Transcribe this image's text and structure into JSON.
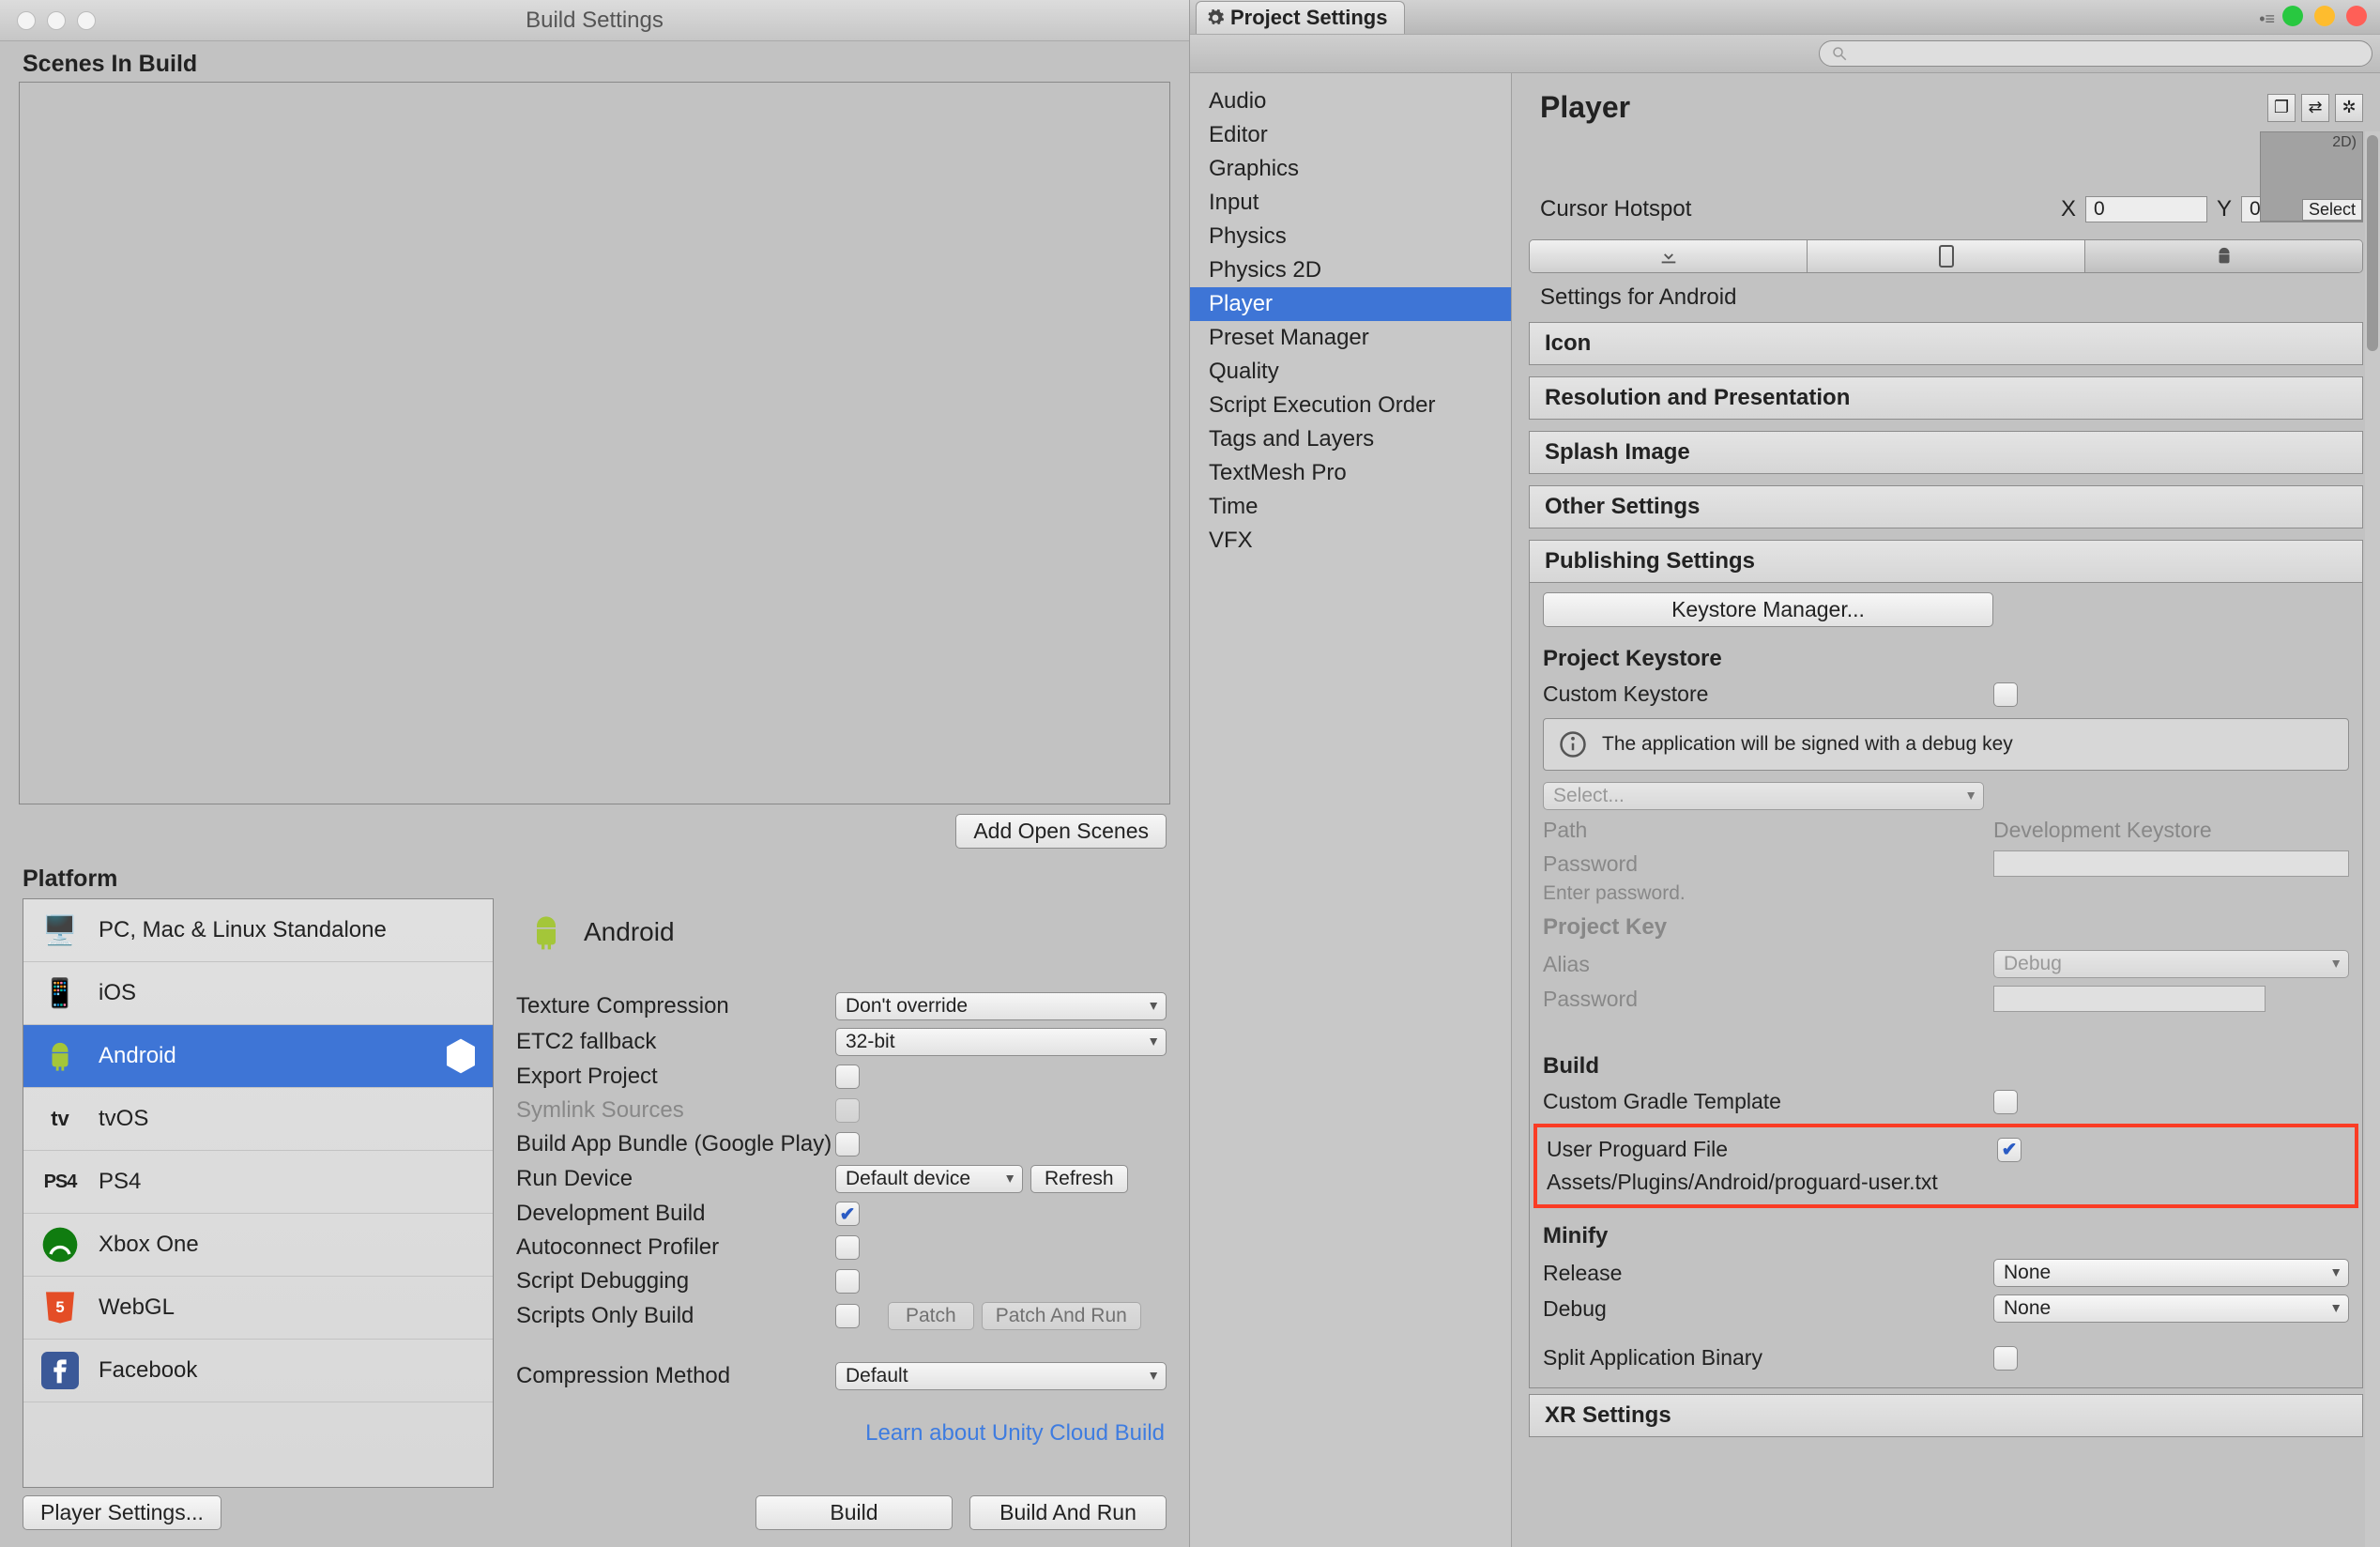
{
  "build": {
    "title": "Build Settings",
    "scenes_label": "Scenes In Build",
    "add_open_scenes": "Add Open Scenes",
    "platform_label": "Platform",
    "platforms": [
      "PC, Mac & Linux Standalone",
      "iOS",
      "Android",
      "tvOS",
      "PS4",
      "Xbox One",
      "WebGL",
      "Facebook"
    ],
    "details_title": "Android",
    "rows": {
      "tex_comp": "Texture Compression",
      "tex_comp_val": "Don't override",
      "etc2": "ETC2 fallback",
      "etc2_val": "32-bit",
      "export": "Export Project",
      "symlink": "Symlink Sources",
      "bundle": "Build App Bundle (Google Play)",
      "run_device": "Run Device",
      "run_device_val": "Default device",
      "refresh": "Refresh",
      "dev_build": "Development Build",
      "autoconnect": "Autoconnect Profiler",
      "script_debug": "Script Debugging",
      "scripts_only": "Scripts Only Build",
      "patch": "Patch",
      "patch_run": "Patch And Run",
      "comp_method": "Compression Method",
      "comp_method_val": "Default"
    },
    "learn_link": "Learn about Unity Cloud Build",
    "player_settings_btn": "Player Settings...",
    "build_btn": "Build",
    "build_run_btn": "Build And Run"
  },
  "settings": {
    "tab_title": "Project Settings",
    "search_placeholder": "",
    "sidebar": [
      "Audio",
      "Editor",
      "Graphics",
      "Input",
      "Physics",
      "Physics 2D",
      "Player",
      "Preset Manager",
      "Quality",
      "Script Execution Order",
      "Tags and Layers",
      "TextMesh Pro",
      "Time",
      "VFX"
    ],
    "sidebar_selected": "Player",
    "main_title": "Player",
    "icon_preview_label": "2D)",
    "icon_select": "Select",
    "cursor_label": "Cursor Hotspot",
    "cursor_x": "0",
    "cursor_y": "0",
    "settings_for": "Settings for Android",
    "foldouts": [
      "Icon",
      "Resolution and Presentation",
      "Splash Image",
      "Other Settings"
    ],
    "publishing_title": "Publishing Settings",
    "keystore_manager": "Keystore Manager...",
    "project_keystore": "Project Keystore",
    "custom_keystore": "Custom Keystore",
    "debug_key_msg": "The application will be signed with a debug key",
    "select_dd": "Select...",
    "path_lbl": "Path",
    "path_val": "Development Keystore",
    "password_lbl": "Password",
    "password_hint": "Enter password.",
    "project_key": "Project Key",
    "alias_lbl": "Alias",
    "alias_val": "Debug",
    "password2_lbl": "Password",
    "build_head": "Build",
    "gradle_lbl": "Custom Gradle Template",
    "proguard_lbl": "User Proguard File",
    "proguard_path": "Assets/Plugins/Android/proguard-user.txt",
    "minify_head": "Minify",
    "release_lbl": "Release",
    "release_val": "None",
    "debug_lbl": "Debug",
    "debug_val": "None",
    "split_lbl": "Split Application Binary",
    "xr_title": "XR Settings"
  }
}
